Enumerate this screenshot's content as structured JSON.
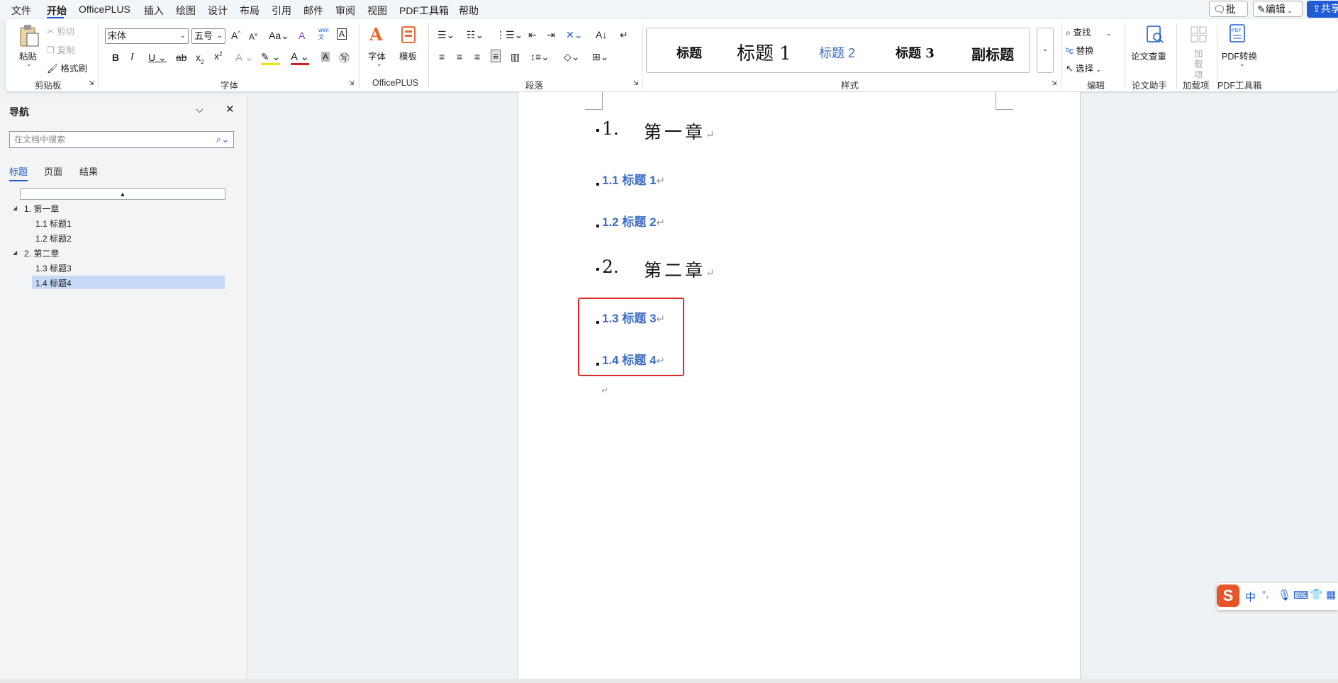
{
  "menu": [
    "文件",
    "开始",
    "OfficePLUS",
    "插入",
    "绘图",
    "设计",
    "布局",
    "引用",
    "邮件",
    "审阅",
    "视图",
    "PDF工具箱",
    "帮助"
  ],
  "topright": {
    "comment": "批注",
    "edit": "编辑",
    "share": "共享"
  },
  "clipboard": {
    "paste": "粘贴",
    "cut": "剪切",
    "copy": "复制",
    "painter": "格式刷",
    "label": "剪贴板"
  },
  "font": {
    "name": "宋体",
    "size": "五号",
    "label": "字体"
  },
  "officeplus": {
    "font": "字体",
    "template": "模板",
    "label": "OfficePLUS"
  },
  "paragraph": {
    "label": "段落"
  },
  "styles": {
    "items": [
      "标题",
      "标题 1",
      "标题 2",
      "标题 3",
      "副标题"
    ],
    "label": "样式"
  },
  "editing": {
    "find": "查找",
    "replace": "替换",
    "select": "选择",
    "label": "编辑"
  },
  "paper": {
    "check": "论文查重",
    "label": "论文助手"
  },
  "addins": {
    "addin": "加载项",
    "label": "加载项"
  },
  "pdf": {
    "convert": "PDF转换",
    "label": "PDF工具箱"
  },
  "nav": {
    "title": "导航",
    "search_placeholder": "在文档中搜索",
    "tabs": [
      "标题",
      "页面",
      "结果"
    ],
    "tree": [
      {
        "text": "1. 第一章",
        "level": 1
      },
      {
        "text": "1.1 标题1",
        "level": 2
      },
      {
        "text": "1.2 标题2",
        "level": 2
      },
      {
        "text": "2. 第二章",
        "level": 1
      },
      {
        "text": "1.3 标题3",
        "level": 2
      },
      {
        "text": "1.4 标题4",
        "level": 2,
        "selected": true
      }
    ]
  },
  "doc": {
    "ch1_num": "1.",
    "ch1_title": "第一章",
    "h11": "1.1 标题 1",
    "h12": "1.2 标题 2",
    "ch2_num": "2.",
    "ch2_title": "第二章",
    "h13": "1.3 标题 3",
    "h14": "1.4 标题 4",
    "para_mark": "↵"
  },
  "ime": {
    "lang": "中",
    "punct": "°,"
  },
  "colors": {
    "accent": "#1f5bd1",
    "heading2": "#3b6bc4",
    "highlight_border": "#e02626",
    "selection": "#c7d9f6"
  }
}
